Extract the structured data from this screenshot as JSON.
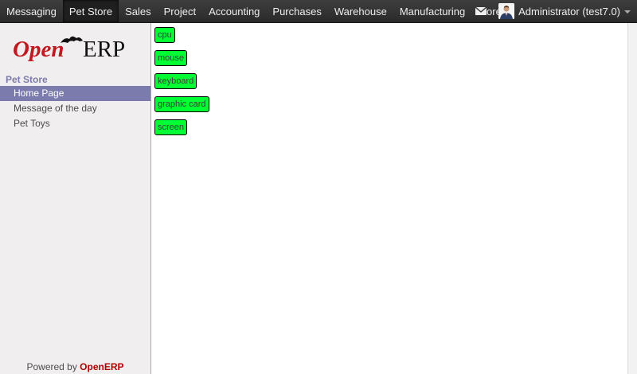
{
  "topbar": {
    "menu": [
      {
        "label": "Messaging",
        "active": false
      },
      {
        "label": "Pet Store",
        "active": true
      },
      {
        "label": "Sales",
        "active": false
      },
      {
        "label": "Project",
        "active": false
      },
      {
        "label": "Accounting",
        "active": false
      },
      {
        "label": "Purchases",
        "active": false
      },
      {
        "label": "Warehouse",
        "active": false
      },
      {
        "label": "Manufacturing",
        "active": false
      }
    ],
    "more_label": "More",
    "user_label": "Administrator (test7.0)"
  },
  "sidebar": {
    "logo": {
      "part1": "Open",
      "part2": "ERP"
    },
    "section_title": "Pet Store",
    "items": [
      {
        "label": "Home Page",
        "selected": true
      },
      {
        "label": "Message of the day",
        "selected": false
      },
      {
        "label": "Pet Toys",
        "selected": false
      }
    ],
    "powered_prefix": "Powered by ",
    "powered_brand": "OpenERP"
  },
  "content": {
    "tags": [
      "cpu",
      "mouse",
      "keyboard",
      "graphic card",
      "screen"
    ]
  },
  "colors": {
    "topbar": "#333333",
    "accent": "#7c7bad",
    "tag_bg": "#00ff33",
    "brand_red": "#b00000"
  }
}
